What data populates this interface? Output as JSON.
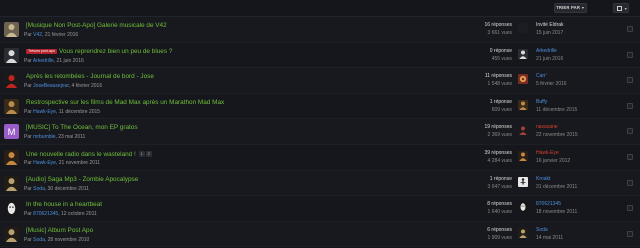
{
  "toolbar": {
    "sort_label": "TRIER PAR",
    "sort_caret": "▼",
    "filter_caret": "▼"
  },
  "threads": [
    {
      "title": "[Musique Non Post-Apo] Galerie musicale de V42",
      "prefix": "",
      "author": "V42",
      "date": "21 février 2016",
      "pages": [],
      "replies": "16 réponses",
      "views": "3 661 vues",
      "last_name": "Invité Eldrak",
      "last_color": "#d8d8d8",
      "last_date": "15 juin 2017"
    },
    {
      "title": "Vous reprendrez bien un peu de blues ?",
      "prefix": "Trésors post-apo",
      "author": "Arkedrille",
      "date": "21 juin 2016",
      "pages": [],
      "replies": "0 réponse",
      "views": "455 vues",
      "last_name": "Arkedrille",
      "last_color": "#4d8fdc",
      "last_date": "21 juin 2016"
    },
    {
      "title": "Après les retombées - Journal de bord - Jose",
      "prefix": "",
      "author": "JoseBeausejour",
      "date": "4 février 2016",
      "pages": [],
      "replies": "11 réponses",
      "views": "1 548 vues",
      "last_name": "Carr'",
      "last_color": "#4d8fdc",
      "last_date": "5 février 2016"
    },
    {
      "title": "Restrospective sur les films de Mad Max après un Marathon Mad Max",
      "prefix": "",
      "author": "Hawk-Eye",
      "date": "11 décembre 2015",
      "pages": [],
      "replies": "1 réponse",
      "views": "609 vues",
      "last_name": "Buffy",
      "last_color": "#4d8fdc",
      "last_date": "11 décembre 2015"
    },
    {
      "title": "[MUSIC] To The Ocean, mon EP gratos",
      "prefix": "",
      "author": "mrbumble",
      "date": "23 mai 2011",
      "pages": [],
      "replies": "19 réponses",
      "views": "2 369 vues",
      "last_name": "navasane",
      "last_color": "#d8402e",
      "last_date": "22 novembre 2015"
    },
    {
      "title": "Une nouvelle radio dans le wasteland !",
      "prefix": "",
      "author": "Hawk-Eye",
      "date": "21 novembre 2011",
      "pages": [
        "1",
        "2"
      ],
      "replies": "39 réponses",
      "views": "4 284 vues",
      "last_name": "Hawk-Eye",
      "last_color": "#d8402e",
      "last_date": "16 janvier 2012"
    },
    {
      "title": "[Audio] Saga Mp3 - Zombie Apocalypse",
      "prefix": "",
      "author": "Soda",
      "date": "30 décembre 2011",
      "pages": [],
      "replies": "1 réponse",
      "views": "3 647 vues",
      "last_name": "Kroakt",
      "last_color": "#4d8fdc",
      "last_date": "31 décembre 2011"
    },
    {
      "title": "In the house in a heartbeat",
      "prefix": "",
      "author": "870621345",
      "date": "12 octobre 2011",
      "pages": [],
      "replies": "8 réponses",
      "views": "1 640 vues",
      "last_name": "870621345",
      "last_color": "#4d8fdc",
      "last_date": "18 novembre 2011"
    },
    {
      "title": "[Music] Album Post Apo",
      "prefix": "",
      "author": "Soda",
      "date": "28 novembre 2010",
      "pages": [],
      "replies": "6 réponses",
      "views": "1 909 vues",
      "last_name": "Soda",
      "last_color": "#4d8fdc",
      "last_date": "14 mai 2011"
    }
  ],
  "by_label": "Par",
  "avatars": [
    {
      "icon": "avatar-soldier-icon",
      "bg": "#6b6250",
      "fg": "#c9b992"
    },
    {
      "icon": "avatar-robot-icon",
      "bg": "#2a2c33",
      "fg": "#d9d9d9"
    },
    {
      "icon": "avatar-red-figure-icon",
      "bg": "#1a1a1a",
      "fg": "#c0241f"
    },
    {
      "icon": "avatar-masked-icon",
      "bg": "#3a2a1a",
      "fg": "#b88c4a"
    },
    {
      "icon": "avatar-letter-m-icon",
      "bg": "#9a5cc8",
      "fg": "#ffffff",
      "letter": "M"
    },
    {
      "icon": "avatar-masked-icon",
      "bg": "#2a1f18",
      "fg": "#c4883e"
    },
    {
      "icon": "avatar-figure-icon",
      "bg": "#201c16",
      "fg": "#b8a070"
    },
    {
      "icon": "avatar-face-icon",
      "bg": "#161616",
      "fg": "#e8e8e8"
    },
    {
      "icon": "avatar-figure-icon",
      "bg": "#201c16",
      "fg": "#b8a070"
    }
  ],
  "last_avatars": [
    {
      "icon": "avatar-blank-icon",
      "bg": "#1c1d22",
      "fg": "#1c1d22"
    },
    {
      "icon": "avatar-robot-icon",
      "bg": "#2a2c33",
      "fg": "#d9d9d9"
    },
    {
      "icon": "avatar-gear-icon",
      "bg": "#7a2a22",
      "fg": "#e0a050"
    },
    {
      "icon": "avatar-masked-icon",
      "bg": "#3a2a1a",
      "fg": "#b88c4a"
    },
    {
      "icon": "avatar-figure-icon",
      "bg": "#1a1a1a",
      "fg": "#a04040"
    },
    {
      "icon": "avatar-masked-icon",
      "bg": "#2a1f18",
      "fg": "#c4883e"
    },
    {
      "icon": "avatar-stick-icon",
      "bg": "#e8e8e8",
      "fg": "#222222"
    },
    {
      "icon": "avatar-face-icon",
      "bg": "#161616",
      "fg": "#e8e8e8"
    },
    {
      "icon": "avatar-figure-icon",
      "bg": "#201c16",
      "fg": "#b8a070"
    }
  ]
}
